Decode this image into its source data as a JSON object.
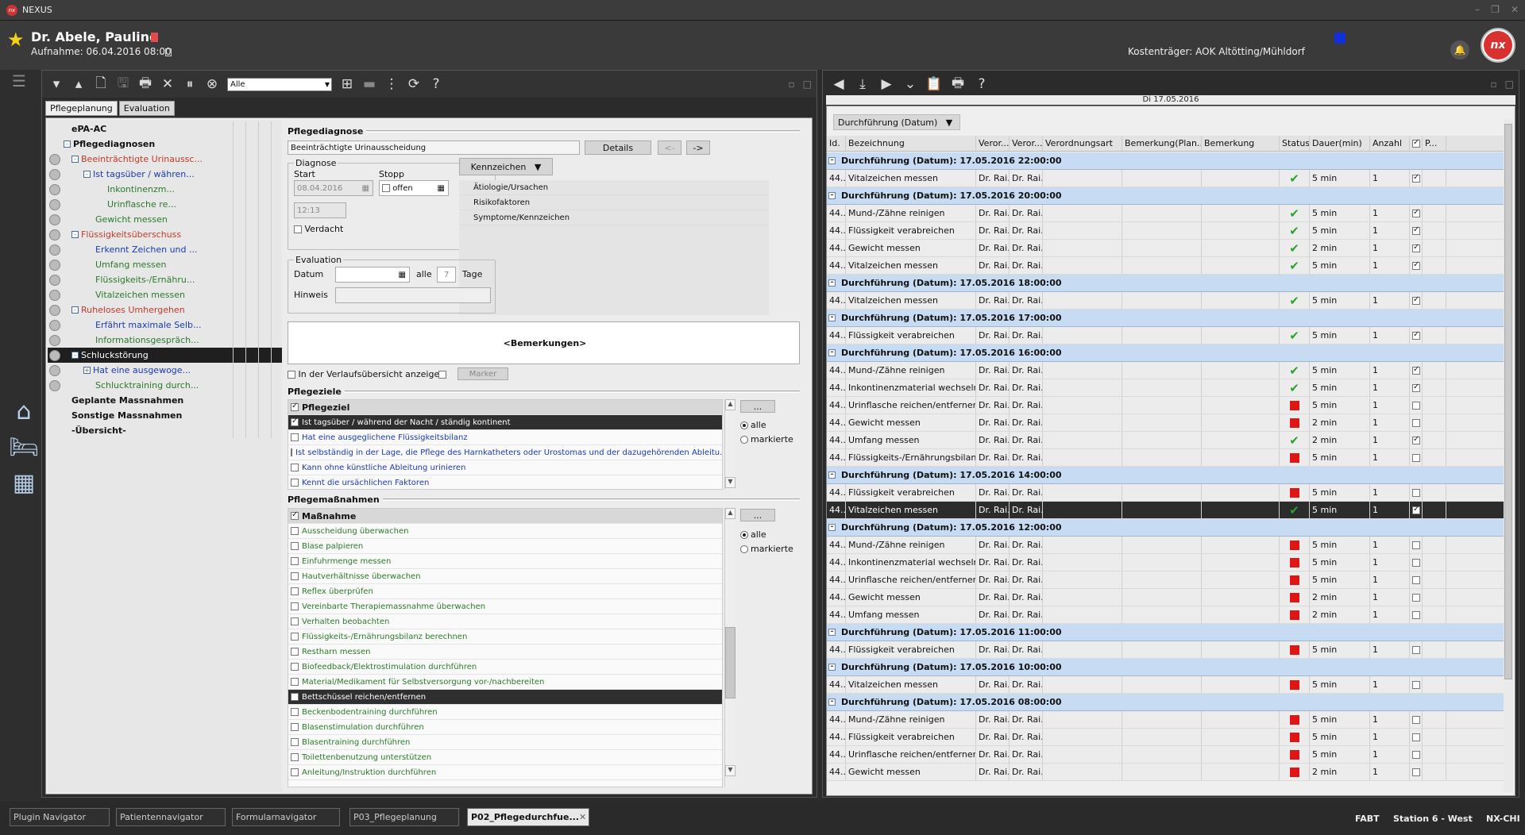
{
  "app": {
    "name": "NEXUS"
  },
  "patient": {
    "name": "Dr. Abele, Pauline",
    "admission": "Aufnahme: 06.04.2016 08:00",
    "payer": "Kostenträger: AOK Altötting/Mühldorf"
  },
  "left_toolbar": {
    "filter_value": "Alle"
  },
  "left_tabs": [
    "Pflegeplanung",
    "Evaluation"
  ],
  "tree": [
    {
      "label": "ePA-AC",
      "cls": "",
      "indent": 30,
      "bold": true
    },
    {
      "label": "Pflegediagnosen",
      "cls": "",
      "indent": 20,
      "bold": true,
      "box": "-"
    },
    {
      "label": "Beeinträchtigte Urinaussc...",
      "cls": "red",
      "indent": 30,
      "box": "-"
    },
    {
      "label": "Ist tagsüber / währen...",
      "cls": "blue",
      "indent": 45,
      "box": "-"
    },
    {
      "label": "Inkontinenzm...",
      "cls": "green",
      "indent": 75
    },
    {
      "label": "Urinflasche re...",
      "cls": "green",
      "indent": 75
    },
    {
      "label": "Gewicht messen",
      "cls": "green",
      "indent": 60
    },
    {
      "label": "Flüssigkeitsüberschuss",
      "cls": "red",
      "indent": 30,
      "box": "-"
    },
    {
      "label": "Erkennt Zeichen und ...",
      "cls": "blue",
      "indent": 60
    },
    {
      "label": "Umfang messen",
      "cls": "green",
      "indent": 60
    },
    {
      "label": "Flüssigkeits-/Ernähru...",
      "cls": "green",
      "indent": 60
    },
    {
      "label": "Vitalzeichen messen",
      "cls": "green",
      "indent": 60
    },
    {
      "label": "Ruheloses Umhergehen",
      "cls": "red",
      "indent": 30,
      "box": "-"
    },
    {
      "label": "Erfährt maximale Selb...",
      "cls": "blue",
      "indent": 60
    },
    {
      "label": "Informationsgespräch...",
      "cls": "green",
      "indent": 60
    },
    {
      "label": "Schluckstörung",
      "cls": "",
      "indent": 30,
      "box": "-",
      "selected": true
    },
    {
      "label": "Hat eine ausgewoge...",
      "cls": "blue",
      "indent": 45,
      "box": "+"
    },
    {
      "label": "Schlucktraining durch...",
      "cls": "green",
      "indent": 60
    },
    {
      "label": "Geplante Massnahmen",
      "cls": "",
      "indent": 30,
      "bold": true
    },
    {
      "label": "Sonstige Massnahmen",
      "cls": "",
      "indent": 30,
      "bold": true
    },
    {
      "label": "-Übersicht-",
      "cls": "",
      "indent": 30,
      "bold": true
    }
  ],
  "form": {
    "diag_title": "Pflegediagnose",
    "diag_value": "Beeinträchtigte Urinausscheidung",
    "details": "Details",
    "prev": "<-",
    "next": "->",
    "diagnose_group": "Diagnose",
    "start_label": "Start",
    "stop_label": "Stopp",
    "start_date": "08.04.2016",
    "stop_value": "offen",
    "time": "12:13",
    "verdacht": "Verdacht",
    "kennzeichen": "Kennzeichen",
    "factors": [
      "Ätiologie/Ursachen",
      "Risikofaktoren",
      "Symptome/Kennzeichen"
    ],
    "evaluation_group": "Evaluation",
    "datum_label": "Datum",
    "alle_label": "alle",
    "alle_value": "7",
    "tage_label": "Tage",
    "hinweis_label": "Hinweis",
    "bemerkungen": "<Bemerkungen>",
    "verlauf": "In der Verlaufsübersicht anzeigen",
    "marker": "Marker",
    "ziele_title": "Pflegeziele",
    "ziele_header": "Pflegeziel",
    "ziele": [
      {
        "label": "Ist tagsüber / während der Nacht / ständig kontinent",
        "checked": true,
        "selected": true
      },
      {
        "label": "Hat eine ausgeglichene Flüssigkeitsbilanz"
      },
      {
        "label": "Ist selbständig in der Lage, die Pflege des Harnkatheters oder Urostomas und der dazugehörenden Ableitu..."
      },
      {
        "label": "Kann ohne künstliche Ableitung urinieren"
      },
      {
        "label": "Kennt die ursächlichen Faktoren"
      }
    ],
    "more": "...",
    "radio_all": "alle",
    "radio_marked": "markierte",
    "massn_title": "Pflegemaßnahmen",
    "massn_header": "Maßnahme",
    "massn": [
      {
        "label": "Ausscheidung überwachen"
      },
      {
        "label": "Blase palpieren"
      },
      {
        "label": "Einfuhrmenge messen"
      },
      {
        "label": "Hautverhältnisse überwachen"
      },
      {
        "label": "Reflex überprüfen"
      },
      {
        "label": "Vereinbarte Therapiemassnahme überwachen"
      },
      {
        "label": "Verhalten beobachten"
      },
      {
        "label": "Flüssigkeits-/Ernährungsbilanz berechnen"
      },
      {
        "label": "Restharn messen"
      },
      {
        "label": "Biofeedback/Elektrostimulation durchführen"
      },
      {
        "label": "Material/Medikament für Selbstversorgung vor-/nachbereiten"
      },
      {
        "label": "Bettschüssel reichen/entfernen",
        "selected": true
      },
      {
        "label": "Beckenbodentraining durchführen"
      },
      {
        "label": "Blasenstimulation durchführen"
      },
      {
        "label": "Blasentraining durchführen"
      },
      {
        "label": "Toilettenbenutzung unterstützen"
      },
      {
        "label": "Anleitung/Instruktion durchführen"
      }
    ]
  },
  "right": {
    "date": "Di 17.05.2016",
    "groupby": "Durchführung (Datum)",
    "columns": [
      "Id.",
      "Bezeichnung",
      "Veror...",
      "Veror...",
      "Verordnungsart",
      "Bemerkung(Plan...",
      "Bemerkung",
      "Status",
      "Dauer(min)",
      "Anzahl",
      "",
      "P..."
    ],
    "groups": [
      {
        "title": "Durchführung (Datum): 17.05.2016 22:00:00",
        "rows": [
          [
            "Vitalzeichen messen",
            "ok",
            "5 min",
            true
          ]
        ]
      },
      {
        "title": "Durchführung (Datum): 17.05.2016 20:00:00",
        "rows": [
          [
            "Mund-/Zähne reinigen",
            "ok",
            "5 min",
            true
          ],
          [
            "Flüssigkeit verabreichen",
            "ok",
            "5 min",
            true
          ],
          [
            "Gewicht messen",
            "ok",
            "2 min",
            true
          ],
          [
            "Vitalzeichen messen",
            "ok",
            "5 min",
            true
          ]
        ]
      },
      {
        "title": "Durchführung (Datum): 17.05.2016 18:00:00",
        "rows": [
          [
            "Vitalzeichen messen",
            "ok",
            "5 min",
            true
          ]
        ]
      },
      {
        "title": "Durchführung (Datum): 17.05.2016 17:00:00",
        "rows": [
          [
            "Flüssigkeit verabreichen",
            "ok",
            "5 min",
            true
          ]
        ]
      },
      {
        "title": "Durchführung (Datum): 17.05.2016 16:00:00",
        "rows": [
          [
            "Mund-/Zähne reinigen",
            "ok",
            "5 min",
            true
          ],
          [
            "Inkontinenzmaterial wechseln",
            "ok",
            "5 min",
            true
          ],
          [
            "Urinflasche reichen/entfernen",
            "red",
            "5 min",
            false
          ],
          [
            "Gewicht messen",
            "red",
            "2 min",
            false
          ],
          [
            "Umfang messen",
            "ok",
            "2 min",
            true
          ],
          [
            "Flüssigkeits-/Ernährungsbilanz berech...",
            "red",
            "5 min",
            false
          ]
        ]
      },
      {
        "title": "Durchführung (Datum): 17.05.2016 14:00:00",
        "rows": [
          [
            "Flüssigkeit verabreichen",
            "red",
            "5 min",
            false
          ],
          [
            "Vitalzeichen messen",
            "ok",
            "5 min",
            true,
            true
          ]
        ]
      },
      {
        "title": "Durchführung (Datum): 17.05.2016 12:00:00",
        "rows": [
          [
            "Mund-/Zähne reinigen",
            "red",
            "5 min",
            false
          ],
          [
            "Inkontinenzmaterial wechseln",
            "red",
            "5 min",
            false
          ],
          [
            "Urinflasche reichen/entfernen",
            "red",
            "5 min",
            false
          ],
          [
            "Gewicht messen",
            "red",
            "2 min",
            false
          ],
          [
            "Umfang messen",
            "red",
            "2 min",
            false
          ]
        ]
      },
      {
        "title": "Durchführung (Datum): 17.05.2016 11:00:00",
        "rows": [
          [
            "Flüssigkeit verabreichen",
            "red",
            "5 min",
            false
          ]
        ]
      },
      {
        "title": "Durchführung (Datum): 17.05.2016 10:00:00",
        "rows": [
          [
            "Vitalzeichen messen",
            "red",
            "5 min",
            false
          ]
        ]
      },
      {
        "title": "Durchführung (Datum): 17.05.2016 08:00:00",
        "rows": [
          [
            "Mund-/Zähne reinigen",
            "red",
            "5 min",
            false
          ],
          [
            "Flüssigkeit verabreichen",
            "red",
            "5 min",
            false
          ],
          [
            "Urinflasche reichen/entfernen",
            "red",
            "5 min",
            false
          ],
          [
            "Gewicht messen",
            "red",
            "2 min",
            false
          ]
        ]
      }
    ],
    "row_id": "44...",
    "row_v1": "Dr. Rai...",
    "row_v2": "Dr. Rai...",
    "row_count": "1"
  },
  "bottom": {
    "tabs": [
      "Plugin Navigator",
      "Patientennavigator",
      "Formularnavigator",
      "P03_Pflegeplanung",
      "P02_Pflegedurchfue..."
    ],
    "status": [
      "FABT",
      "Station 6 - West",
      "NX-CHI"
    ]
  },
  "colors": {
    "group_bg": "#c7dcf2",
    "status_red": "#e01515",
    "status_ok": "#2aa52a"
  }
}
